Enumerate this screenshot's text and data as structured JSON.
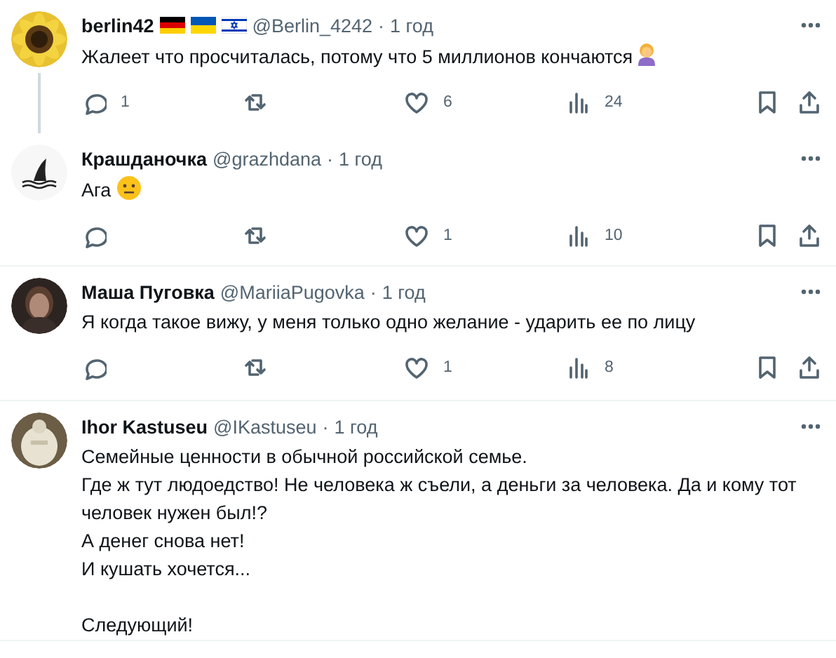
{
  "tweets": [
    {
      "name": "berlin42",
      "flags": [
        {
          "kind": "de"
        },
        {
          "kind": "ua"
        },
        {
          "kind": "il"
        }
      ],
      "handle": "@Berlin_4242",
      "separator": "·",
      "time": "1 год",
      "paragraphs": [
        [
          "Жалеет что просчиталась, потому что 5 миллионов кончаются"
        ]
      ],
      "emoji": {
        "kind": "facepalm"
      },
      "thread": true,
      "replies": "1",
      "likes": "6",
      "views": "24"
    },
    {
      "name": "Крашданочка",
      "handle": "@grazhdana",
      "separator": "·",
      "time": "1 год",
      "paragraphs": [
        [
          "Ага"
        ]
      ],
      "emoji": {
        "kind": "neutral"
      },
      "thread": false,
      "likes": "1",
      "views": "10"
    },
    {
      "name": "Маша Пуговка",
      "handle": "@MariiaPugovka",
      "separator": "·",
      "time": "1 год",
      "paragraphs": [
        [
          "Я когда такое вижу, у меня только одно желание - ударить ее по лицу"
        ]
      ],
      "thread": false,
      "likes": "1",
      "views": "8"
    },
    {
      "name": "Ihor Kastuseu",
      "handle": "@IKastuseu",
      "separator": "·",
      "time": "1 год",
      "paragraphs": [
        [
          "Семейные ценности в обычной российской семье.",
          "Где ж тут людоедство! Не человека ж съели, а деньги за человека. Да и кому тот человек нужен был!?",
          "А денег снова нет!",
          "И кушать хочется..."
        ],
        [
          "Следующий!"
        ]
      ],
      "thread": false
    }
  ]
}
